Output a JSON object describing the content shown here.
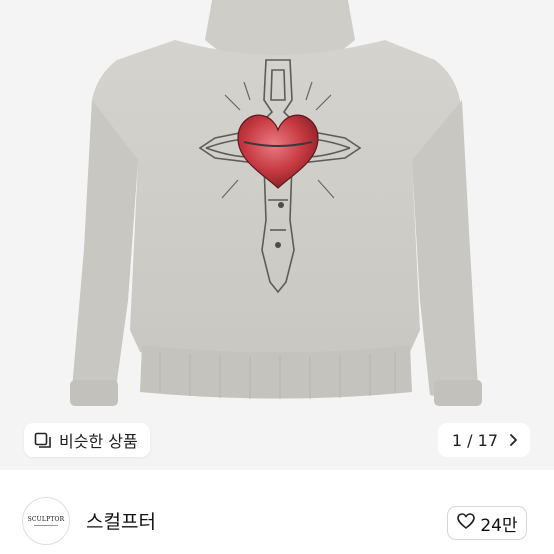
{
  "gallery": {
    "similar_label": "비슷한 상품",
    "counter": "1 / 17",
    "image_subject": "sweatshirt-back-print"
  },
  "seller": {
    "logo_text": "SCULPTOR",
    "name": "스컬프터"
  },
  "like": {
    "count": "24만"
  },
  "colors": {
    "garment": "#cdcbc6",
    "background": "#f4f4f5",
    "heart": "#c83a42"
  }
}
